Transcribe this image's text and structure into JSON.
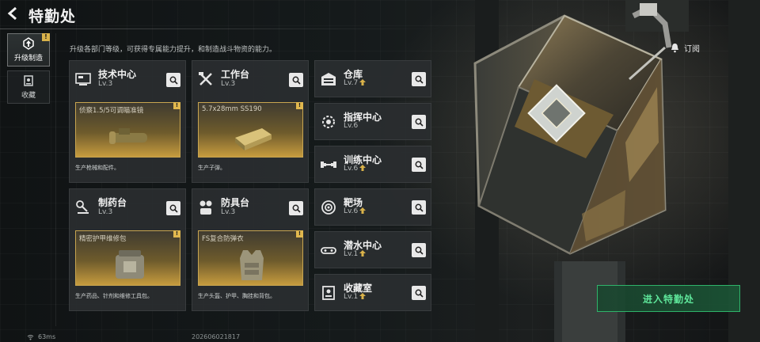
{
  "header": {
    "title": "特勤处"
  },
  "sidebar": {
    "items": [
      {
        "label": "升级制造",
        "badge": "!",
        "active": true,
        "icon": "upgrade-icon"
      },
      {
        "label": "收藏",
        "icon": "collection-icon"
      }
    ]
  },
  "description": "升级各部门等级，可获得专属能力提升，和制造战斗物资的能力。",
  "workshops": [
    {
      "name": "技术中心",
      "level": "Lv.3",
      "icon": "tech-center-icon",
      "product": "侦察1.5/5可调瞄准镜",
      "product_badge": "!",
      "footer": "生产枪械和配件。"
    },
    {
      "name": "工作台",
      "level": "Lv.3",
      "icon": "workbench-icon",
      "product": "5.7x28mm SS190",
      "product_badge": "!",
      "footer": "生产子弹。"
    },
    {
      "name": "制药台",
      "level": "Lv.3",
      "icon": "pharmacy-icon",
      "product": "精密护甲维修包",
      "product_badge": "!",
      "footer": "生产药品、针剂和维修工具包。"
    },
    {
      "name": "防具台",
      "level": "Lv.3",
      "icon": "armor-bench-icon",
      "product": "FS复合防弹衣",
      "product_badge": "!",
      "footer": "生产头盔、护甲、胸挂和背包。"
    }
  ],
  "facilities": [
    {
      "name": "仓库",
      "level": "Lv.7",
      "upgradable": true,
      "icon": "warehouse-icon"
    },
    {
      "name": "指挥中心",
      "level": "Lv.6",
      "upgradable": false,
      "icon": "command-center-icon"
    },
    {
      "name": "训练中心",
      "level": "Lv.6",
      "upgradable": true,
      "icon": "training-center-icon"
    },
    {
      "name": "靶场",
      "level": "Lv.6",
      "upgradable": true,
      "icon": "shooting-range-icon"
    },
    {
      "name": "潜水中心",
      "level": "Lv.1",
      "upgradable": true,
      "icon": "diving-center-icon"
    },
    {
      "name": "收藏室",
      "level": "Lv.1",
      "upgradable": true,
      "icon": "collection-room-icon"
    }
  ],
  "subscribe_label": "订阅",
  "enter_button": "进入特勤处",
  "status": {
    "ping": "63ms",
    "build": "202606021817"
  },
  "colors": {
    "accent_green": "#2fb36a",
    "gold": "#d9b24a"
  }
}
